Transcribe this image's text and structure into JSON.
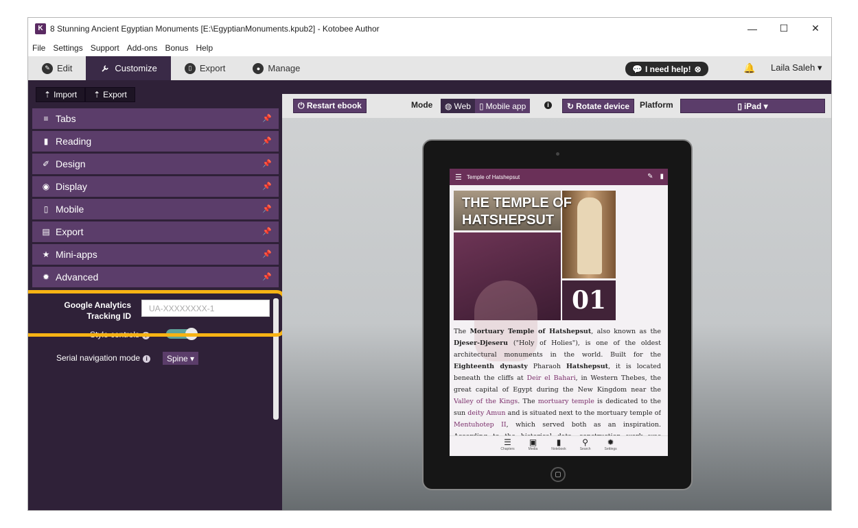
{
  "window": {
    "title": "8 Stunning Ancient Egyptian Monuments [E:\\EgyptianMonuments.kpub2] - Kotobee Author",
    "controls": [
      "—",
      "☐",
      "✕"
    ]
  },
  "menu": [
    "File",
    "Settings",
    "Support",
    "Add-ons",
    "Bonus",
    "Help"
  ],
  "tabs": [
    {
      "label": "Edit",
      "icon": "pencil-icon",
      "glyph": "✎"
    },
    {
      "label": "Customize",
      "icon": "wrench-icon",
      "glyph": "✈"
    },
    {
      "label": "Export",
      "icon": "device-icon",
      "glyph": "▯"
    },
    {
      "label": "Manage",
      "icon": "user-icon",
      "glyph": "●"
    }
  ],
  "header": {
    "help_label": "I need help!",
    "user_name": "Laila Saleh ▾",
    "bell_glyph": "🔔"
  },
  "left": {
    "import_label": "Import",
    "export_label": "Export",
    "sections": [
      {
        "label": "Tabs",
        "icon": "list-icon",
        "glyph": "≡"
      },
      {
        "label": "Reading",
        "icon": "bookmark-icon",
        "glyph": "▮"
      },
      {
        "label": "Design",
        "icon": "brush-icon",
        "glyph": "✐"
      },
      {
        "label": "Display",
        "icon": "eye-icon",
        "glyph": "◉"
      },
      {
        "label": "Mobile",
        "icon": "mobile-icon",
        "glyph": "▯"
      },
      {
        "label": "Export",
        "icon": "pdf-icon",
        "glyph": "▤"
      },
      {
        "label": "Mini-apps",
        "icon": "star-icon",
        "glyph": "★"
      },
      {
        "label": "Advanced",
        "icon": "gear-icon",
        "glyph": "✹"
      }
    ],
    "ga_label": "Google Analytics Tracking ID",
    "ga_placeholder": "UA-XXXXXXXX-1",
    "style_controls_label": "Style controls",
    "serial_label": "Serial navigation mode",
    "serial_value": "Spine ▾"
  },
  "toolbar": {
    "restart_label": "⏻ Restart ebook",
    "mode_label": "Mode",
    "web_label": "Web",
    "mobile_app_label": "Mobile app",
    "rotate_label": "Rotate device",
    "platform_label": "Platform",
    "platform_value": "iPad ▾"
  },
  "ebook": {
    "chapter_title": "Temple of Hatshepsut",
    "cover_title": "THE TEMPLE OF HATSHEPSUT",
    "chapter_number": "01",
    "paragraph_html_parts": [],
    "nav": [
      {
        "label": "Chapters",
        "glyph": "☰"
      },
      {
        "label": "Media",
        "glyph": "▣"
      },
      {
        "label": "Notebook",
        "glyph": "▮"
      },
      {
        "label": "Search",
        "glyph": "⚲"
      },
      {
        "label": "Settings",
        "glyph": "✹"
      }
    ]
  }
}
